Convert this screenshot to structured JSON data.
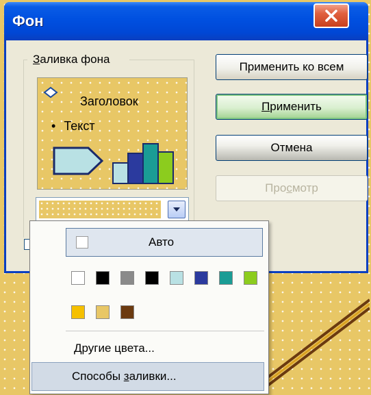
{
  "window": {
    "title": "Фон",
    "close_icon": "close-icon"
  },
  "fill_group": {
    "label": "Заливка фона",
    "preview": {
      "heading": "Заголовок",
      "bullet_text": "Текст",
      "bullet_char": "•",
      "colors": {
        "background": "#e8c766",
        "arrow_fill": "#b9e1e4",
        "bars": [
          "#b9e1e4",
          "#2b3a9e",
          "#1a9c95",
          "#8ccc1e"
        ]
      }
    },
    "current_color": "#e8c766"
  },
  "buttons": {
    "apply_all": "Применить ко всем",
    "apply": "Применить",
    "cancel": "Отмена",
    "preview": "Просмотр"
  },
  "color_menu": {
    "auto_label": "Авто",
    "palette_row1": [
      "#ffffff",
      "#000000",
      "#8a8a8a",
      "#000000",
      "#b9e1e4",
      "#2b3a9e",
      "#1a9c95",
      "#8ccc1e"
    ],
    "palette_row2": [
      "#f5c000",
      "#e8c766",
      "#6b3a10"
    ],
    "more_colors": "Другие цвета...",
    "fill_effects": "Способы заливки..."
  }
}
